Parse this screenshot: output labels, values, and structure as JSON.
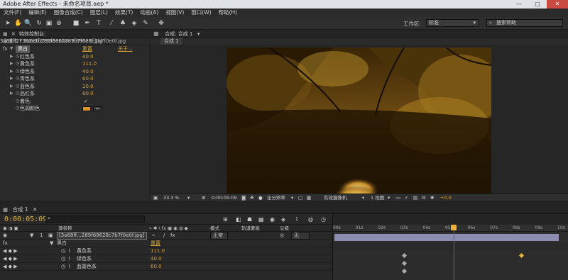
{
  "window": {
    "title": "Adobe After Effects - 未命名项目.aep *"
  },
  "menu": [
    "文件(F)",
    "编辑(E)",
    "图像合成(C)",
    "图层(L)",
    "效果(T)",
    "动画(A)",
    "视图(V)",
    "窗口(W)",
    "帮助(H)"
  ],
  "toolbar": {
    "workspace_label": "工作区:",
    "workspace_value": "标准",
    "search_placeholder": "搜索帮助"
  },
  "effect_controls": {
    "tab_label": "特效控制台: 3a68ff27363e1b289f69628c7b7f0e0f.jpg",
    "subhead": "合成 1 • 3a68ff27363e1b289f69628c7b7f0e0f.jpg",
    "effect_name": "黑白",
    "reset_label": "重置",
    "about_label": "关于...",
    "params": [
      {
        "name": "红色系",
        "value": "40.0"
      },
      {
        "name": "黄色系",
        "value": "111.0"
      },
      {
        "name": "绿色系",
        "value": "40.0"
      },
      {
        "name": "青色系",
        "value": "60.0"
      },
      {
        "name": "蓝色系",
        "value": "20.0"
      },
      {
        "name": "品红系",
        "value": "80.0"
      }
    ],
    "tint_label": "着色:",
    "tint_check": "✓",
    "tint_color_label": "色调颜色",
    "tint_color": "#d9942a"
  },
  "comp_viewer": {
    "tab_label": "合成: 合成 1",
    "subtab": "合成 1",
    "zoom": "33.3 %",
    "timecode": "0:00:05:09",
    "resolution": "全分辨率",
    "camera": "有效摄像机",
    "views": "1 视图",
    "exposure": "+0.0"
  },
  "timeline": {
    "tab_label": "合成 1",
    "timecode": "0:00:05:09",
    "columns": {
      "source_name": "源名称",
      "mode": "模式",
      "track_matte": "轨道蒙板",
      "parent": "父级"
    },
    "layer": {
      "index": "1",
      "name": "[3a68ff...289f69628c7b7f0e0f.jpg]",
      "mode": "正常",
      "parent": "无"
    },
    "effect_row": {
      "name": "黑白",
      "reset": "重置"
    },
    "props": [
      {
        "name": "黄色系",
        "value": "111.0"
      },
      {
        "name": "绿色系",
        "value": "40.0"
      },
      {
        "name": "蓝基色系",
        "value": "60.0"
      }
    ],
    "ruler": [
      "00s",
      "01s",
      "02s",
      "03s",
      "04s",
      "05s",
      "06s",
      "07s",
      "08s",
      "09s",
      "10s"
    ],
    "accent": "#e8b33a"
  }
}
